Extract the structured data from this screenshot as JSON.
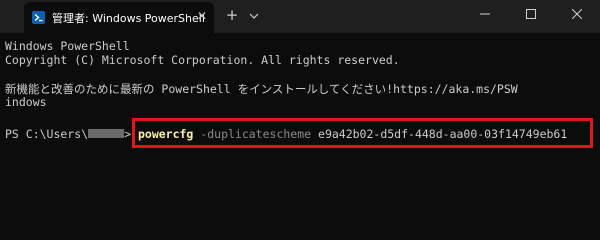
{
  "window": {
    "tab_title": "管理者: Windows PowerShell",
    "tab_close_glyph": "✕",
    "new_tab_glyph": "+",
    "icons": {
      "app": "powershell-icon",
      "dropdown": "chevron-down-icon",
      "minimize": "minimize-icon",
      "maximize": "maximize-icon",
      "close": "close-icon"
    }
  },
  "terminal": {
    "lines": [
      "Windows PowerShell",
      "Copyright (C) Microsoft Corporation. All rights reserved.",
      "新機能と改善のために最新の PowerShell をインストールしてください!https://aka.ms/PSW",
      "indows"
    ],
    "prompt_prefix": "PS C:\\Users\\",
    "prompt_suffix": ">",
    "command": "powercfg",
    "parameter": "-duplicatescheme",
    "argument": "e9a42b02-d5df-448d-aa00-03f14749eb61"
  },
  "colors": {
    "background": "#0c0c0c",
    "titlebar": "#1f1f1f",
    "text": "#cccccc",
    "command": "#f9f1a5",
    "parameter": "#8a8a8a",
    "highlight_border": "#e0161b"
  }
}
